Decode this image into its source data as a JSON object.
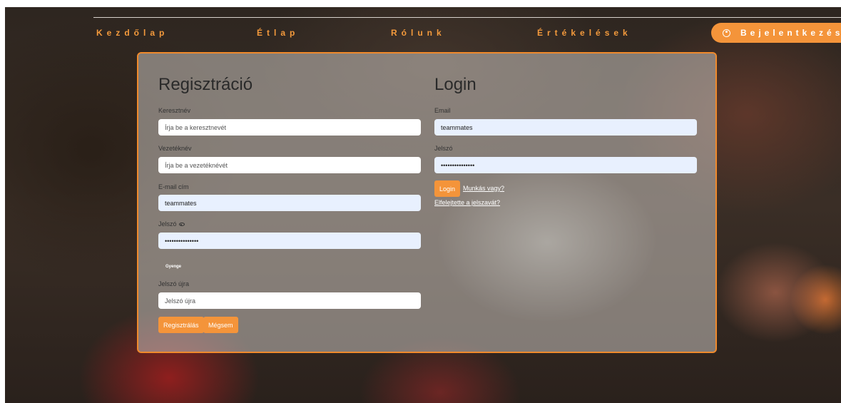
{
  "nav": {
    "home": "Kezdőlap",
    "menu": "Étlap",
    "about": "Rólunk",
    "reviews": "Értékelések",
    "login": "Bejelentkezés"
  },
  "register": {
    "title": "Regisztráció",
    "first_name_label": "Keresztnév",
    "first_name_placeholder": "Írja be a keresztnevét",
    "last_name_label": "Vezetéknév",
    "last_name_placeholder": "Írja be a vezetéknévét",
    "email_label": "E-mail cím",
    "email_value": "teammates",
    "password_label": "Jelszó",
    "password_value": "•••••••••••••••",
    "strength": "Gyenge",
    "password_again_label": "Jelszó újra",
    "password_again_placeholder": "Jelszó újra",
    "submit_label": "Regisztrálás",
    "cancel_label": "Mégsem"
  },
  "login": {
    "title": "Login",
    "email_label": "Email",
    "email_value": "teammates",
    "password_label": "Jelszó",
    "password_value": "•••••••••••••••",
    "submit_label": "Login",
    "worker_link": "Munkás vagy?",
    "forgot_link": "Elfelejtette a jelszavát?"
  },
  "colors": {
    "accent": "#f4943a",
    "card_border": "#f08a2c",
    "autofill_bg": "#e8f0fe"
  }
}
